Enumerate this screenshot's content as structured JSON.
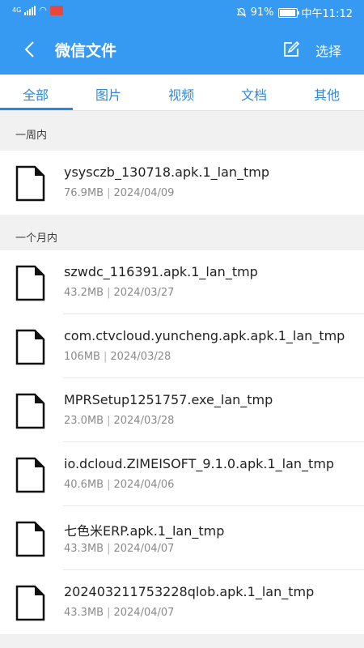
{
  "status": {
    "network": "4G",
    "battery": "91%",
    "time": "中午11:12"
  },
  "header": {
    "title": "微信文件",
    "select_label": "选择"
  },
  "tabs": [
    {
      "label": "全部"
    },
    {
      "label": "图片"
    },
    {
      "label": "视频"
    },
    {
      "label": "文档"
    },
    {
      "label": "其他"
    }
  ],
  "sections": [
    {
      "title": "一周内"
    },
    {
      "title": "一个月内"
    }
  ],
  "files": [
    {
      "name": "ysysczb_130718.apk.1_lan_tmp",
      "size": "76.9MB",
      "date": "2024/04/09"
    },
    {
      "name": "szwdc_116391.apk.1_lan_tmp",
      "size": "43.2MB",
      "date": "2024/03/27"
    },
    {
      "name": "com.ctvcloud.yuncheng.apk.apk.1_lan_tmp",
      "size": "106MB",
      "date": "2024/03/28"
    },
    {
      "name": "MPRSetup1251757.exe_lan_tmp",
      "size": "23.0MB",
      "date": "2024/03/28"
    },
    {
      "name": "io.dcloud.ZIMEISOFT_9.1.0.apk.1_lan_tmp",
      "size": "40.6MB",
      "date": "2024/04/06"
    },
    {
      "name": "七色米ERP.apk.1_lan_tmp",
      "size": "43.3MB",
      "date": "2024/04/07"
    },
    {
      "name": "202403211753228qlob.apk.1_lan_tmp",
      "size": "43.3MB",
      "date": "2024/04/07"
    }
  ],
  "colors": {
    "primary": "#379af2",
    "tab_active": "#2b88e0"
  }
}
